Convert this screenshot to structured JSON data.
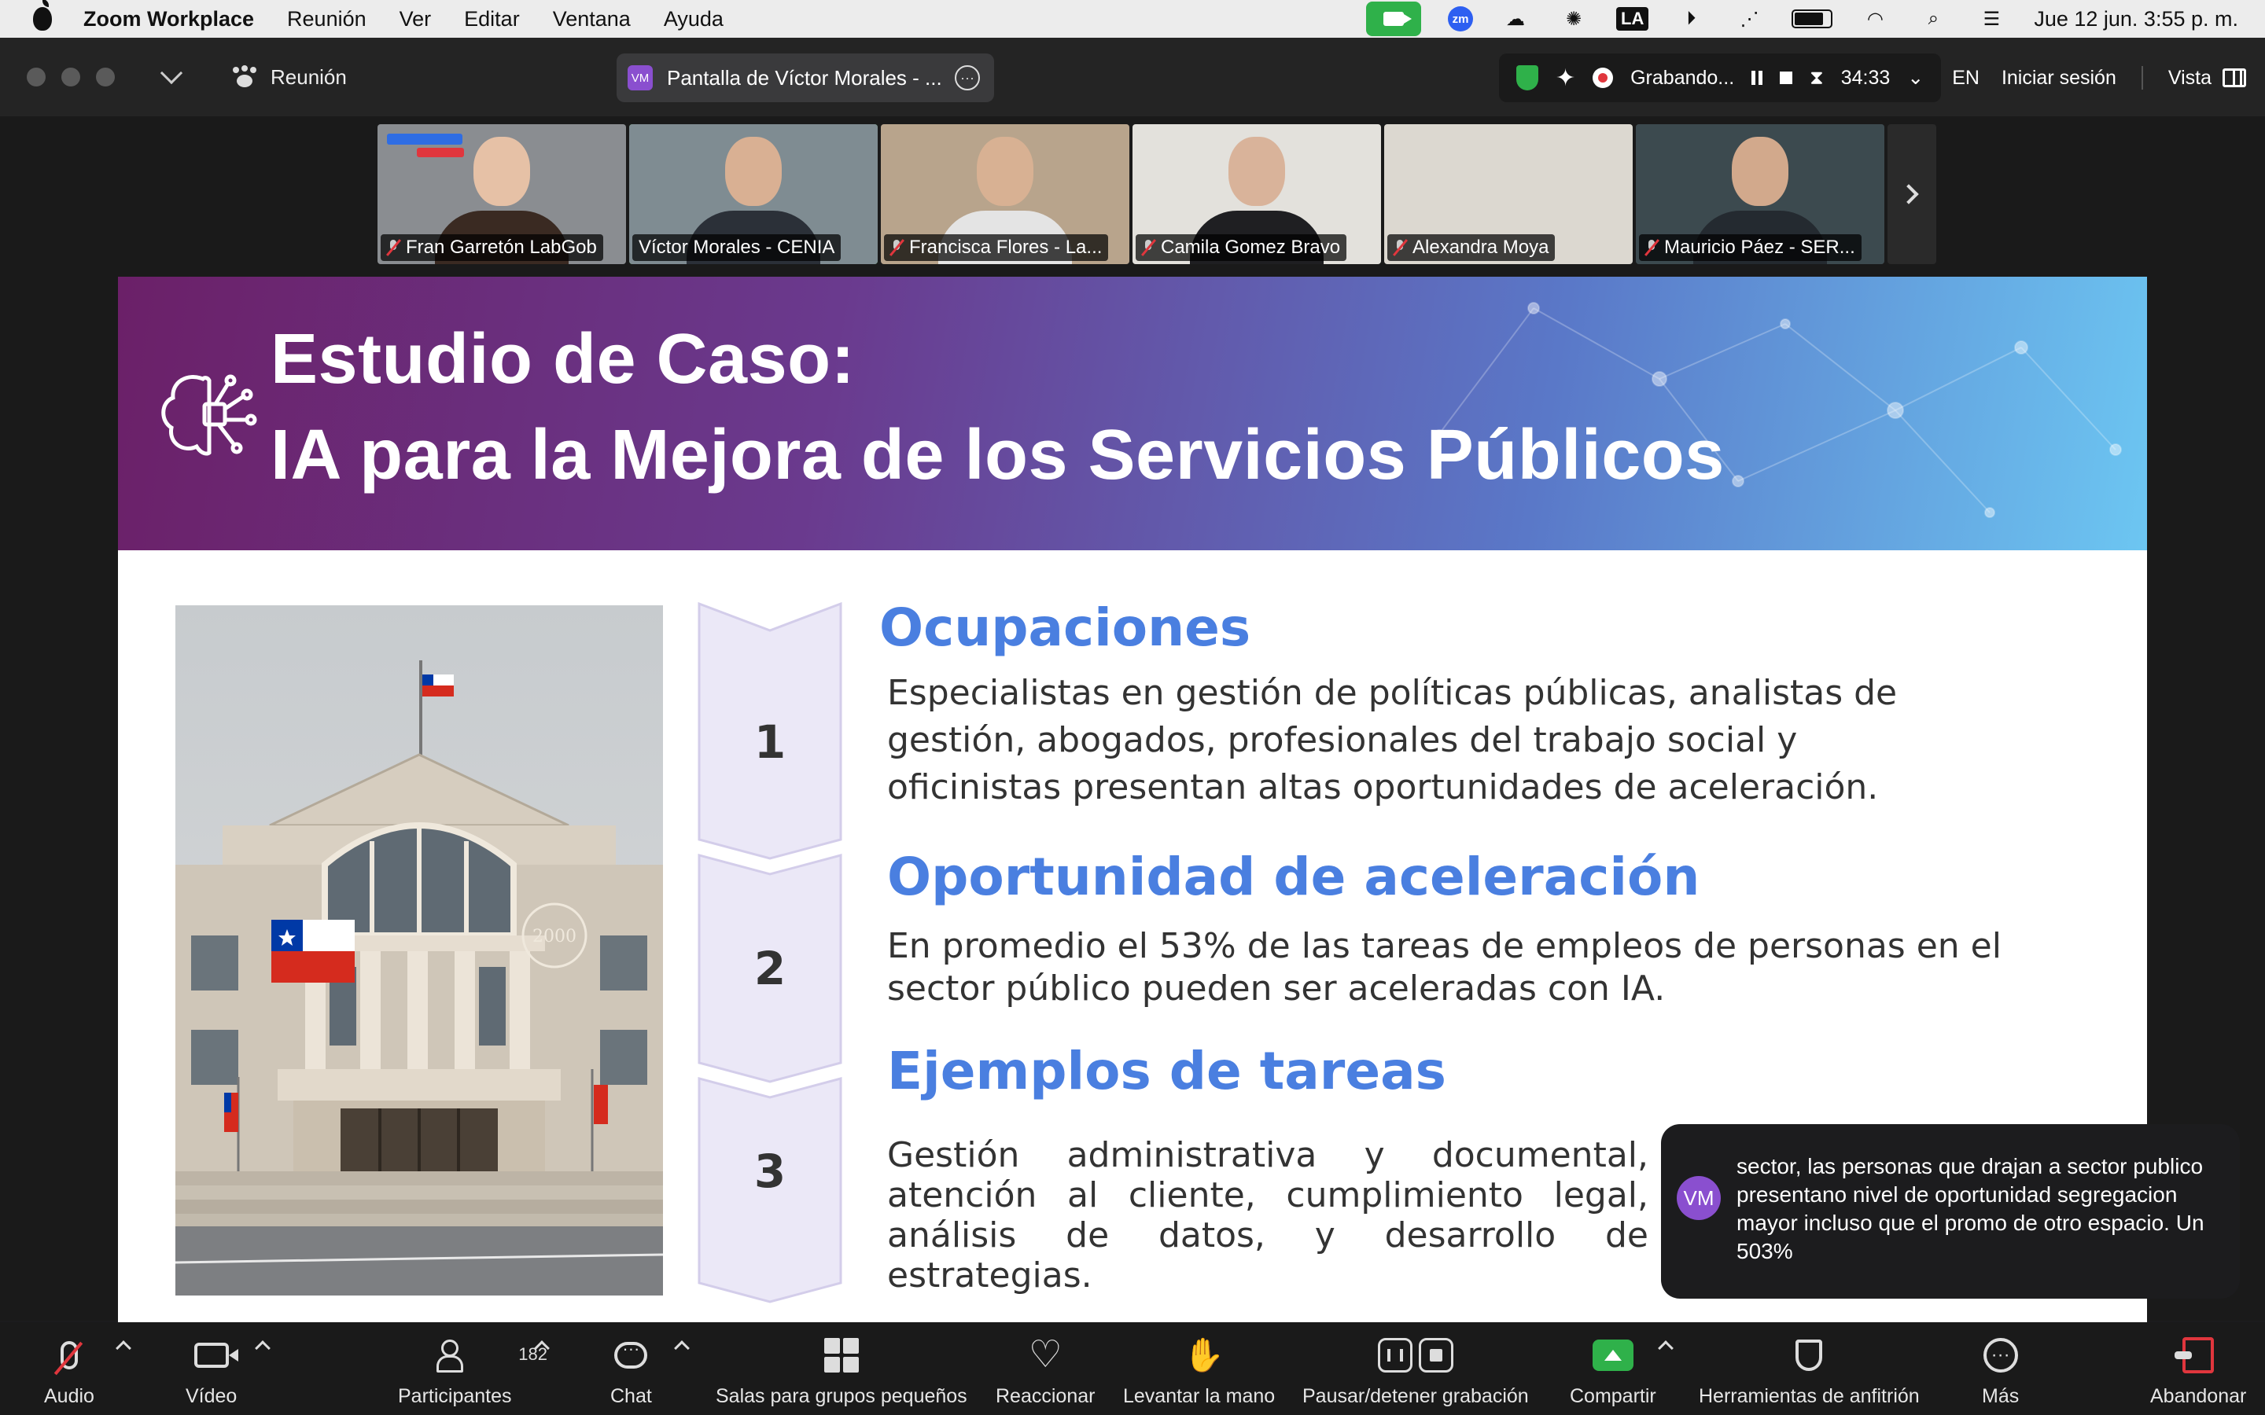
{
  "menubar": {
    "app_name": "Zoom Workplace",
    "items": [
      "Reunión",
      "Ver",
      "Editar",
      "Ventana",
      "Ayuda"
    ],
    "zoom_badge": "zm",
    "input_source": "LA",
    "datetime": "Jue 12 jun.  3:55 p. m."
  },
  "titlebar": {
    "meeting_label": "Reunión",
    "share_initials": "VM",
    "share_title": "Pantalla de Víctor Morales - ...",
    "recording_label": "Grabando...",
    "timer": "34:33",
    "language": "EN",
    "sign_in": "Iniciar sesión",
    "view": "Vista"
  },
  "participants": [
    {
      "name": "Fran Garretón LabGob",
      "muted": true,
      "active": false,
      "bg": "#8a8d91",
      "skin": "#e6c1a6",
      "shirt": "#3a2a22"
    },
    {
      "name": "Víctor Morales - CENIA",
      "muted": false,
      "active": true,
      "bg": "#7f8c92",
      "skin": "#d9b093",
      "shirt": "#2b3038"
    },
    {
      "name": "Francisca Flores - La...",
      "muted": true,
      "active": false,
      "bg": "#b8a48c",
      "skin": "#d8b193",
      "shirt": "#e4e4e4"
    },
    {
      "name": "Camila Gomez Bravo",
      "muted": true,
      "active": false,
      "bg": "#e3e1dc",
      "skin": "#d9b39a",
      "shirt": "#1f1f22"
    },
    {
      "name": "Alexandra Moya",
      "muted": true,
      "active": false,
      "bg": "#dcd8d0",
      "skin": "#dcd8d0",
      "shirt": "#dcd8d0"
    },
    {
      "name": "Mauricio Páez - SER...",
      "muted": true,
      "active": false,
      "bg": "#3c4a4f",
      "skin": "#d2a98c",
      "shirt": "#242a30"
    }
  ],
  "slide": {
    "title_line1": "Estudio de Caso:",
    "title_line2": "IA para la Mejora de los Servicios Públicos",
    "steps": [
      "1",
      "2",
      "3"
    ],
    "sections": [
      {
        "heading": "Ocupaciones",
        "text": "Especialistas en gestión de políticas públicas, analistas de gestión, abogados, profesionales del trabajo social y oficinistas presentan altas oportunidades de aceleración."
      },
      {
        "heading": "Oportunidad de aceleración",
        "text": "En promedio el  53% de las tareas de  empleos de  personas en el sector público pueden ser aceleradas con IA."
      },
      {
        "heading": "Ejemplos de tareas",
        "text": "Gestión administrativa y documental, atención al cliente, cumplimiento legal, análisis de datos, y desarrollo de estrategias."
      }
    ],
    "building_sign": "2000",
    "colors": {
      "heading_blue": "#4a7fe0",
      "banner_start": "#6b2068",
      "banner_end": "#6cc6f2",
      "step_fill": "#ebe8f7"
    }
  },
  "caption": {
    "initials": "VM",
    "text": "sector, las personas que drajan a sector publico presentano nivel de oportunidad segregacion mayor incluso que el promo de otro espacio. Un 503%"
  },
  "toolbar": {
    "audio": "Audio",
    "video": "Vídeo",
    "participants": "Participantes",
    "participants_count": "182",
    "chat": "Chat",
    "breakout": "Salas para grupos pequeños",
    "react": "Reaccionar",
    "raise_hand": "Levantar la mano",
    "recording": "Pausar/detener grabación",
    "share": "Compartir",
    "host_tools": "Herramientas de anfitrión",
    "more": "Más",
    "leave": "Abandonar"
  }
}
